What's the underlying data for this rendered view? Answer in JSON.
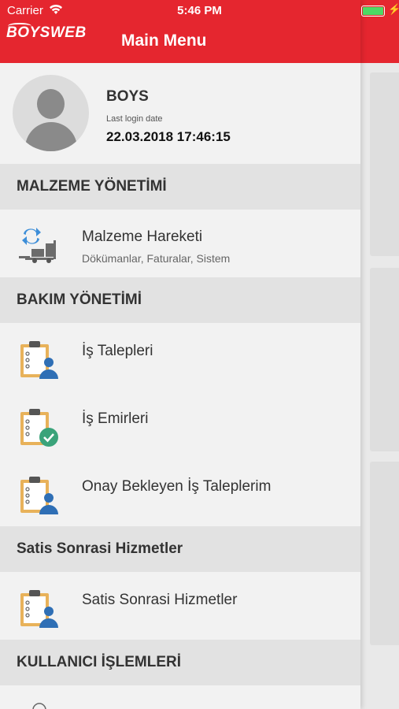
{
  "status_bar": {
    "carrier": "Carrier",
    "time": "5:46 PM"
  },
  "header": {
    "logo": "BOYSWEB",
    "title": "Main Menu"
  },
  "profile": {
    "name": "BOYS",
    "last_login_label": "Last login date",
    "last_login_value": "22.03.2018 17:46:15"
  },
  "sections": [
    {
      "title": "MALZEME YÖNETİMİ",
      "items": [
        {
          "label": "Malzeme Hareketi",
          "subtitle": "Dökümanlar, Faturalar, Sistem",
          "icon": "forklift-transfer-icon"
        }
      ]
    },
    {
      "title": "BAKIM YÖNETİMİ",
      "items": [
        {
          "label": "İş Talepleri",
          "icon": "clipboard-user-icon"
        },
        {
          "label": "İş Emirleri",
          "icon": "clipboard-check-icon"
        },
        {
          "label": "Onay Bekleyen İş Taleplerim",
          "icon": "clipboard-user-icon"
        }
      ]
    },
    {
      "title": "Satis Sonrasi Hizmetler",
      "items": [
        {
          "label": "Satis Sonrasi Hizmetler",
          "icon": "clipboard-user-icon"
        }
      ]
    },
    {
      "title": "KULLANICI İŞLEMLERİ",
      "items": []
    }
  ],
  "colors": {
    "brand_red": "#e5262f",
    "section_bg": "#e2e2e2",
    "item_bg": "#f2f2f2",
    "clipboard": "#e8b25a",
    "user_blue": "#2f6fb5",
    "check_green": "#3aa37a",
    "forklift_blue": "#3d8ed8"
  }
}
